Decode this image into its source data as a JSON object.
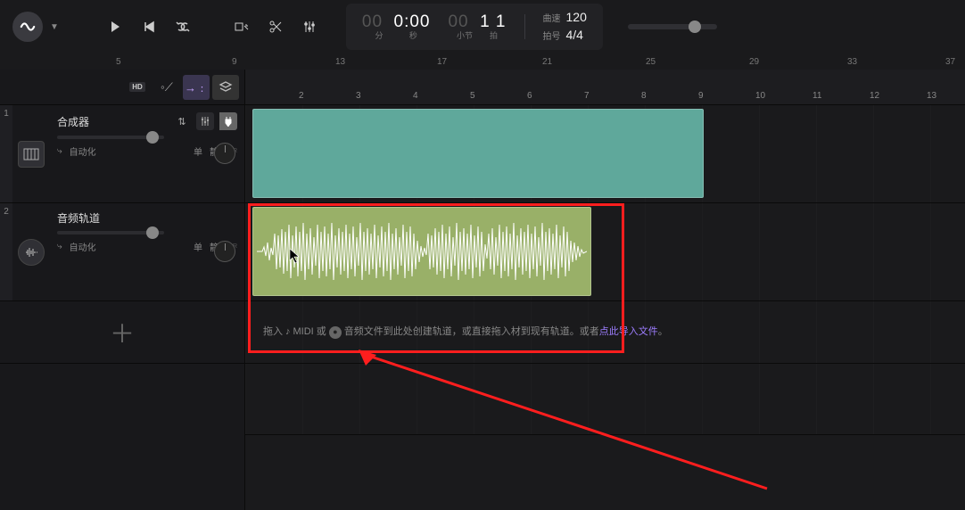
{
  "transport": {
    "time_minutes_lead": "00",
    "time_main": "0:00",
    "time_sub_left": "分",
    "time_sub_right": "秒",
    "bar_lead": "00",
    "bar_main": "1  1",
    "bar_sub_left": "小节",
    "bar_sub_right": "拍",
    "tempo_label": "曲速",
    "tempo_value": "120",
    "sig_label": "拍号",
    "sig_value": "4/4"
  },
  "top_ruler": {
    "ticks": [
      "5",
      "9",
      "13",
      "17",
      "21",
      "25",
      "29",
      "33",
      "37"
    ]
  },
  "tools": {
    "hd": "HD"
  },
  "timeline_ruler": {
    "ticks": [
      "2",
      "3",
      "4",
      "5",
      "6",
      "7",
      "8",
      "9",
      "10",
      "11",
      "12",
      "13"
    ]
  },
  "tracks": [
    {
      "num": "1",
      "name": "合成器",
      "auto": "自动化",
      "solo": "单",
      "mute": "静",
      "icon": "piano"
    },
    {
      "num": "2",
      "name": "音频轨道",
      "auto": "自动化",
      "solo": "单",
      "mute": "静",
      "icon": "wave"
    }
  ],
  "dropzone": {
    "prefix": "拖入 ",
    "midi": "MIDI 或 ",
    "mid": "音频文件到此处创建轨道，或直接拖入",
    "mid2": "材到现有轨道。或者 ",
    "link": "点此导入文件",
    "suffix": "。"
  }
}
